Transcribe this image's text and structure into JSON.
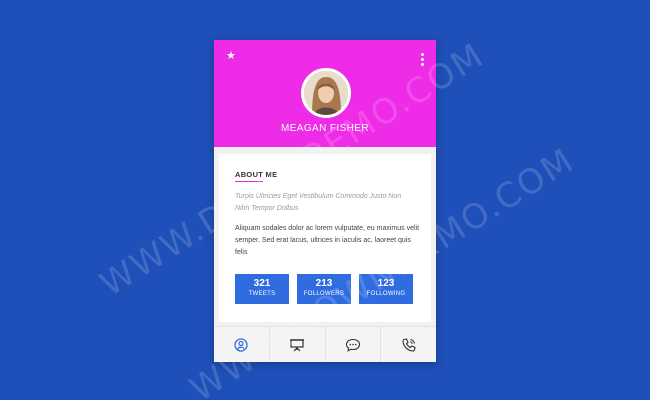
{
  "profile": {
    "name": "MEAGAN FISHER",
    "header_color": "#ee2be6",
    "accent_color": "#2f6ce0"
  },
  "about": {
    "title": "ABOUT ME",
    "quote": "Turpis Ultricies Eget Vestibulum Commodo Justo Non Nibh Tempor Dolbus",
    "description": "Aliquam sodales dolor ac lorem vulputate, eu maximus velit semper. Sed erat lacus, ultrices in iaculis ac, laoreet quis felis"
  },
  "stats": [
    {
      "value": "321",
      "label": "TWEETS"
    },
    {
      "value": "213",
      "label": "FOLLOWERS"
    },
    {
      "value": "123",
      "label": "FOLLOWING"
    }
  ],
  "footer_icons": [
    "profile-icon",
    "presentation-icon",
    "chat-icon",
    "phone-icon"
  ],
  "header_icons": [
    "star-icon",
    "more-vertical-icon"
  ],
  "watermark": "WWW.DOWNDEMO.COM"
}
